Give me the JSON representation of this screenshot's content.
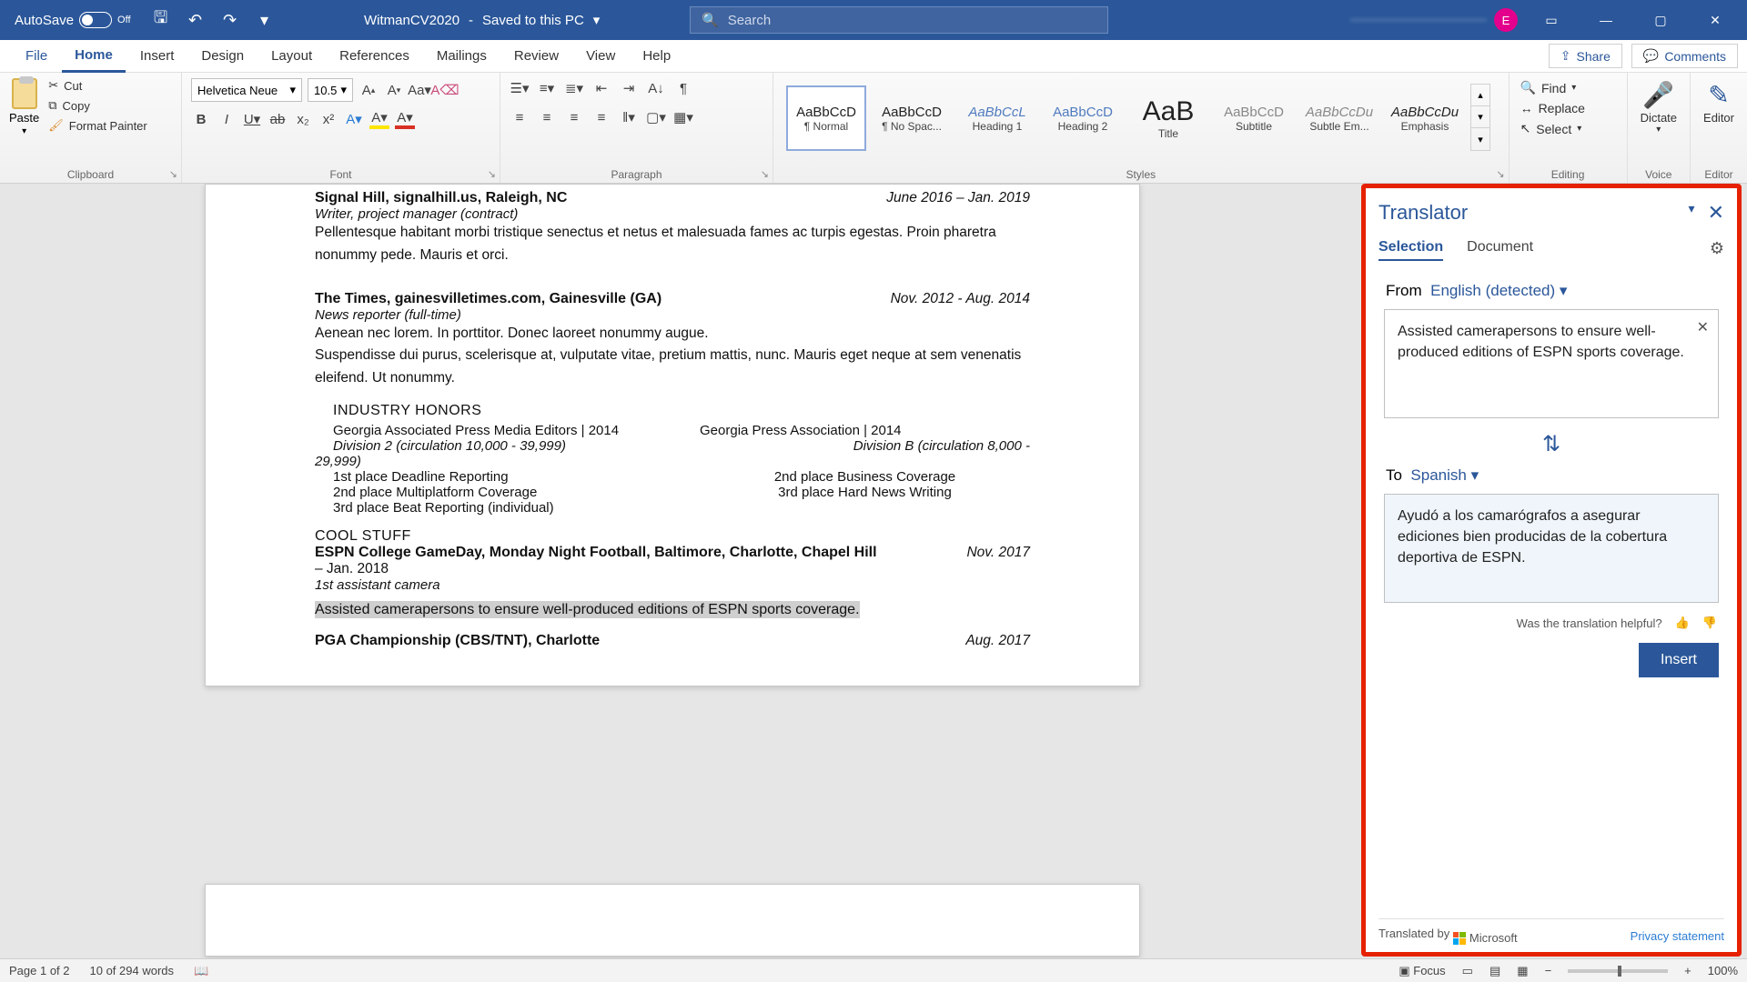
{
  "titlebar": {
    "autosave": "AutoSave",
    "toggle_state": "Off",
    "doc_name": "WitmanCV2020",
    "save_state": "Saved to this PC",
    "search_placeholder": "Search",
    "avatar_initial": "E"
  },
  "tabs": {
    "file": "File",
    "home": "Home",
    "insert": "Insert",
    "design": "Design",
    "layout": "Layout",
    "references": "References",
    "mailings": "Mailings",
    "review": "Review",
    "view": "View",
    "help": "Help",
    "share": "Share",
    "comments": "Comments"
  },
  "ribbon": {
    "paste": "Paste",
    "cut": "Cut",
    "copy": "Copy",
    "format_painter": "Format Painter",
    "clipboard": "Clipboard",
    "font_name": "Helvetica Neue",
    "font_size": "10.5",
    "font_group": "Font",
    "paragraph": "Paragraph",
    "styles_group": "Styles",
    "styles": [
      {
        "label": "¶ Normal",
        "prev": "AaBbCcD"
      },
      {
        "label": "¶ No Spac...",
        "prev": "AaBbCcD"
      },
      {
        "label": "Heading 1",
        "prev": "AaBbCcL"
      },
      {
        "label": "Heading 2",
        "prev": "AaBbCcD"
      },
      {
        "label": "Title",
        "prev": "AaB"
      },
      {
        "label": "Subtitle",
        "prev": "AaBbCcD"
      },
      {
        "label": "Subtle Em...",
        "prev": "AaBbCcDu"
      },
      {
        "label": "Emphasis",
        "prev": "AaBbCcDu"
      }
    ],
    "find": "Find",
    "replace": "Replace",
    "select": "Select",
    "editing": "Editing",
    "dictate": "Dictate",
    "voice": "Voice",
    "editor": "Editor",
    "editor_group": "Editor"
  },
  "doc": {
    "job1_title": "Signal Hill, signalhill.us, Raleigh, NC",
    "job1_dates": "June 2016 – Jan. 2019",
    "job1_role": "Writer, project manager (contract)",
    "job1_body1": "Pellentesque habitant morbi tristique senectus et netus et malesuada fames ac turpis egestas. Proin pharetra nonummy pede. Mauris et orci.",
    "job2_title": "The Times, gainesvilletimes.com, Gainesville (GA)",
    "job2_dates": "Nov. 2012 - Aug. 2014",
    "job2_role": "News reporter (full-time)",
    "job2_body1": "Aenean nec lorem. In porttitor. Donec laoreet nonummy augue.",
    "job2_body2": "Suspendisse dui purus, scelerisque at, vulputate vitae, pretium mattis, nunc. Mauris eget neque at sem venenatis eleifend. Ut nonummy.",
    "honors_header": "INDUSTRY HONORS",
    "honors_left_title": "Georgia Associated Press Media Editors | 2014",
    "honors_left_div": "Division 2 (circulation 10,000 - 39,999)",
    "honors_left_extra": "29,999)",
    "honors_left1": "1st place Deadline Reporting",
    "honors_left2": "2nd place Multiplatform Coverage",
    "honors_left3": "3rd place Beat Reporting (individual)",
    "honors_right_title": "Georgia Press Association | 2014",
    "honors_right_div": "Division B (circulation 8,000 -",
    "honors_right1": "2nd place Business Coverage",
    "honors_right2": "3rd place Hard News Writing",
    "cool_header": "COOL STUFF",
    "cool_title": "ESPN College GameDay, Monday Night Football, Baltimore, Charlotte, Chapel Hill",
    "cool_dates": "Nov. 2017",
    "cool_dates2": "– Jan. 2018",
    "cool_role": "1st assistant camera",
    "cool_body": "Assisted camerapersons to ensure well-produced editions of ESPN sports coverage.",
    "pga_title": "PGA Championship (CBS/TNT), Charlotte",
    "pga_dates": "Aug. 2017"
  },
  "translator": {
    "title": "Translator",
    "tab_selection": "Selection",
    "tab_document": "Document",
    "from_label": "From",
    "from_lang": "English (detected)",
    "source_text": "Assisted camerapersons to ensure well-produced editions of ESPN sports coverage.",
    "to_label": "To",
    "to_lang": "Spanish",
    "target_text": "Ayudó a los camarógrafos a asegurar ediciones bien producidas de la cobertura deportiva de ESPN.",
    "feedback_prompt": "Was the translation helpful?",
    "insert": "Insert",
    "translated_by": "Translated by",
    "ms": "Microsoft",
    "privacy": "Privacy statement"
  },
  "status": {
    "page": "Page 1 of 2",
    "words": "10 of 294 words",
    "focus": "Focus",
    "zoom": "100%"
  }
}
